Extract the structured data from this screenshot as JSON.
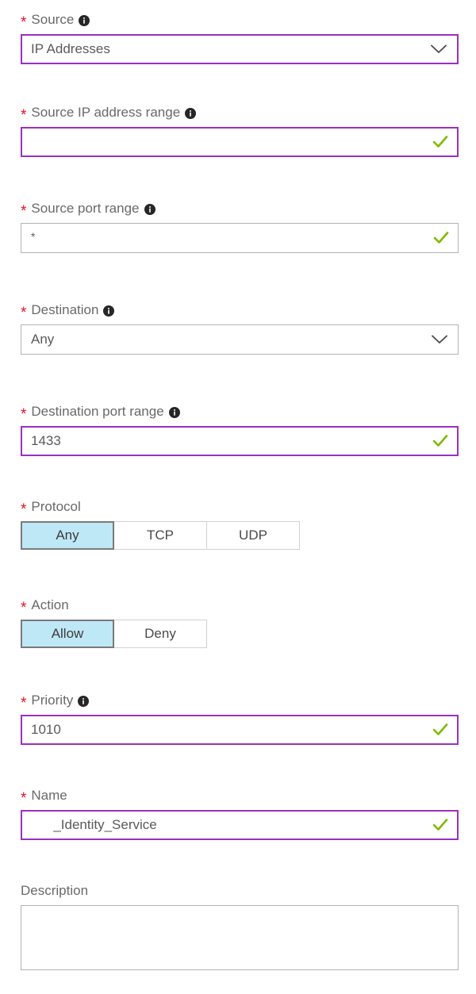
{
  "theme": {
    "accent_border": "#9b30c0",
    "plain_border": "#b3b3b3",
    "required_star": "#e81123",
    "label_text": "#696969",
    "value_text": "#5a5a5a",
    "validation_check": "#7fba00",
    "toggle_selected_bg": "#bfe8f7",
    "toggle_selected_border": "#7a7a7a",
    "toggle_border": "#d2d2d2",
    "page_bg": "#ffffff"
  },
  "required_marker": "*",
  "icons": {
    "info": "info-icon",
    "chevron_down": "chevron-down-icon",
    "validation_check": "check-icon"
  },
  "fields": {
    "source": {
      "label": "Source",
      "required": true,
      "has_info": true,
      "type": "dropdown",
      "value": "IP Addresses",
      "options": [
        "IP Addresses"
      ],
      "border": "accent"
    },
    "source_ip_range": {
      "label": "Source IP address range",
      "required": true,
      "has_info": true,
      "type": "text",
      "value": "",
      "placeholder": "",
      "valid": true,
      "border": "accent"
    },
    "source_port_range": {
      "label": "Source port range",
      "required": true,
      "has_info": true,
      "type": "text",
      "value": "*",
      "placeholder": "",
      "valid": true,
      "border": "plain"
    },
    "destination": {
      "label": "Destination",
      "required": true,
      "has_info": true,
      "type": "dropdown",
      "value": "Any",
      "options": [
        "Any"
      ],
      "border": "plain"
    },
    "destination_port_range": {
      "label": "Destination port range",
      "required": true,
      "has_info": true,
      "type": "text",
      "value": "1433",
      "placeholder": "",
      "valid": true,
      "border": "accent"
    },
    "protocol": {
      "label": "Protocol",
      "required": true,
      "has_info": false,
      "type": "toggle",
      "options": [
        "Any",
        "TCP",
        "UDP"
      ],
      "selected": "Any"
    },
    "action": {
      "label": "Action",
      "required": true,
      "has_info": false,
      "type": "toggle",
      "options": [
        "Allow",
        "Deny"
      ],
      "selected": "Allow"
    },
    "priority": {
      "label": "Priority",
      "required": true,
      "has_info": true,
      "type": "text",
      "value": "1010",
      "placeholder": "",
      "valid": true,
      "border": "accent"
    },
    "name": {
      "label": "Name",
      "required": true,
      "has_info": false,
      "type": "text",
      "value": "      _Identity_Service",
      "placeholder": "",
      "valid": true,
      "border": "accent"
    },
    "description": {
      "label": "Description",
      "required": false,
      "has_info": false,
      "type": "textarea",
      "value": "",
      "placeholder": "",
      "border": "plain"
    }
  }
}
